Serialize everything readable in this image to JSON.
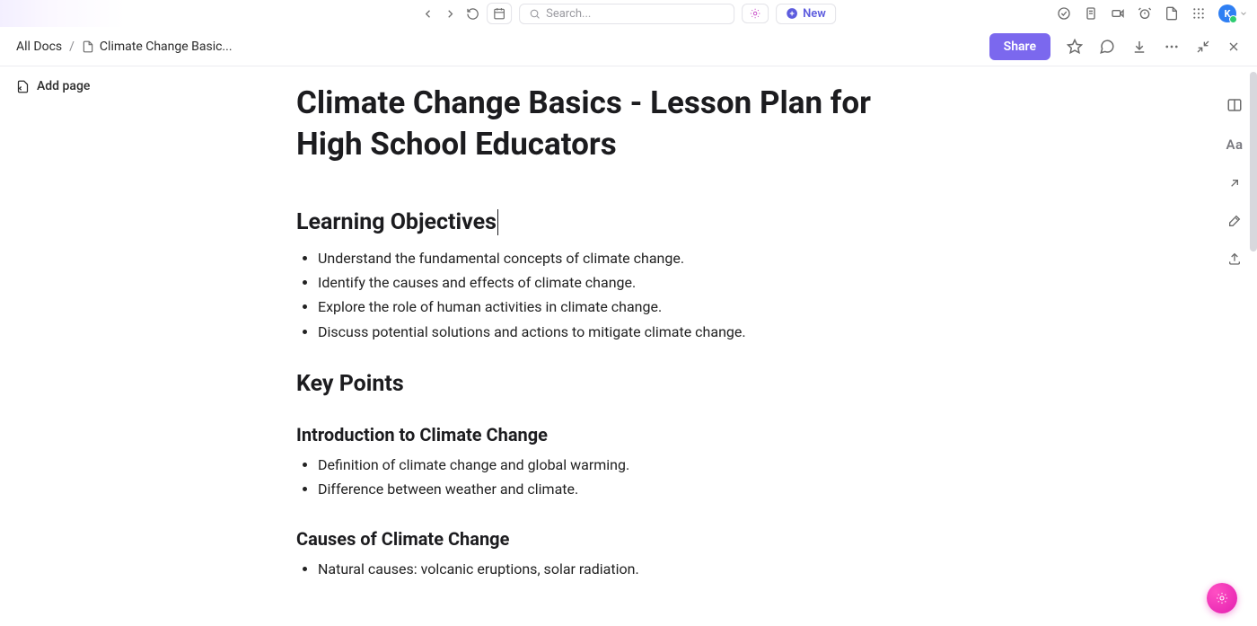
{
  "topbar": {
    "search_placeholder": "Search...",
    "new_label": "New",
    "avatar_initial": "K"
  },
  "breadcrumb": {
    "root": "All Docs",
    "separator": "/",
    "current": "Climate Change Basic..."
  },
  "actions": {
    "share_label": "Share"
  },
  "sidebar": {
    "add_page_label": "Add page"
  },
  "right_rail": {
    "font_label": "Aa"
  },
  "document": {
    "title": "Climate Change Basics - Lesson Plan for High School Educators",
    "sections": {
      "learning_objectives": {
        "heading": "Learning Objectives",
        "items": [
          "Understand the fundamental concepts of climate change.",
          "Identify the causes and effects of climate change.",
          "Explore the role of human activities in climate change.",
          "Discuss potential solutions and actions to mitigate climate change."
        ]
      },
      "key_points": {
        "heading": "Key Points"
      },
      "intro": {
        "heading": "Introduction to Climate Change",
        "items": [
          "Definition of climate change and global warming.",
          "Difference between weather and climate."
        ]
      },
      "causes": {
        "heading": "Causes of Climate Change",
        "items": [
          "Natural causes: volcanic eruptions, solar radiation."
        ]
      }
    }
  }
}
